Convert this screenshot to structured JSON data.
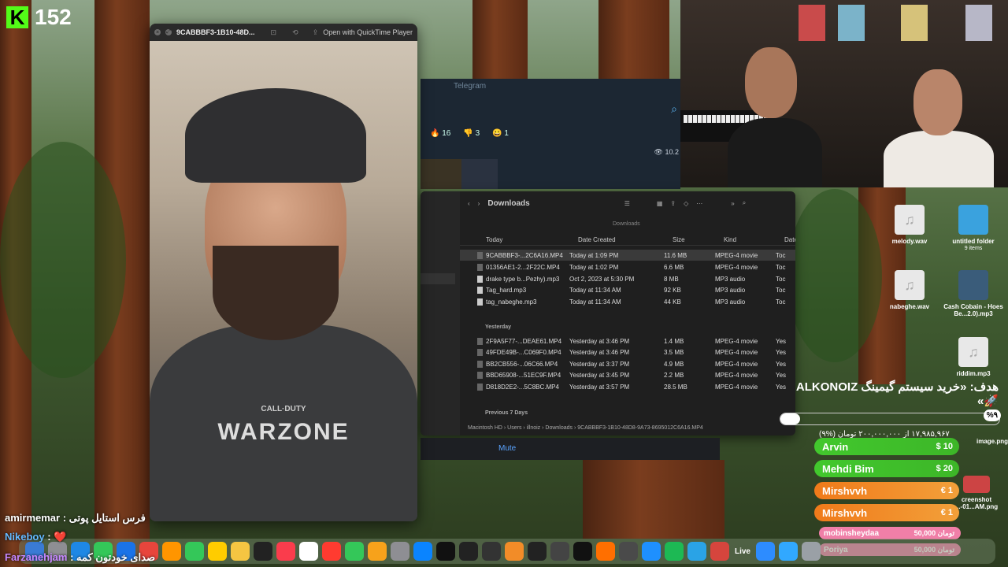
{
  "kick": {
    "count": "152",
    "logo": "K"
  },
  "quicktime": {
    "title": "9CABBBF3-1B10-48D...",
    "open_label": "Open with QuickTime Player",
    "hoodie_small": "CALL·DUTY",
    "hoodie_big": "WARZONE"
  },
  "telegram": {
    "title": "Telegram",
    "reactions": [
      "🔥 16",
      "👎 3",
      "😀 1"
    ],
    "views": "👁 10.2"
  },
  "finder": {
    "title": "Downloads",
    "subtitle": "Downloads",
    "columns": {
      "name": "Today",
      "date": "Date Created",
      "size": "Size",
      "kind": "Kind",
      "extra": "Date"
    },
    "sections": {
      "today": "Today",
      "yesterday": "Yesterday",
      "previous": "Previous 7 Days"
    },
    "today_rows": [
      {
        "name": "9CABBBF3-...2C6A16.MP4",
        "date": "Today at 1:09 PM",
        "size": "11.6 MB",
        "kind": "MPEG-4 movie",
        "extra": "Toc"
      },
      {
        "name": "01356AE1-2...2F22C.MP4",
        "date": "Today at 1:02 PM",
        "size": "6.6 MB",
        "kind": "MPEG-4 movie",
        "extra": "Toc"
      },
      {
        "name": "drake type b...Pezhy).mp3",
        "date": "Oct 2, 2023 at 5:30 PM",
        "size": "8 MB",
        "kind": "MP3 audio",
        "extra": "Toc"
      },
      {
        "name": "Tag_hard.mp3",
        "date": "Today at 11:34 AM",
        "size": "92 KB",
        "kind": "MP3 audio",
        "extra": "Toc"
      },
      {
        "name": "tag_nabeghe.mp3",
        "date": "Today at 11:34 AM",
        "size": "44 KB",
        "kind": "MP3 audio",
        "extra": "Toc"
      }
    ],
    "yesterday_rows": [
      {
        "name": "2F9A5F77-...DEAE61.MP4",
        "date": "Yesterday at 3:46 PM",
        "size": "1.4 MB",
        "kind": "MPEG-4 movie",
        "extra": "Yes"
      },
      {
        "name": "49FDE49B-...C069F0.MP4",
        "date": "Yesterday at 3:46 PM",
        "size": "3.5 MB",
        "kind": "MPEG-4 movie",
        "extra": "Yes"
      },
      {
        "name": "BB2CB556-...06C66.MP4",
        "date": "Yesterday at 3:37 PM",
        "size": "4.9 MB",
        "kind": "MPEG-4 movie",
        "extra": "Yes"
      },
      {
        "name": "BBD65908-...51EC9F.MP4",
        "date": "Yesterday at 3:45 PM",
        "size": "2.2 MB",
        "kind": "MPEG-4 movie",
        "extra": "Yes"
      },
      {
        "name": "D818D2E2-...5C8BC.MP4",
        "date": "Yesterday at 3:57 PM",
        "size": "28.5 MB",
        "kind": "MPEG-4 movie",
        "extra": "Yes"
      }
    ],
    "path": "Macintosh HD  ›  Users  ›  illnoiz  ›  Downloads  ›  9CABBBF3-1B10-48D8-9A73-8695012C6A16.MP4"
  },
  "mute_label": "Mute",
  "desktop_icons": [
    {
      "label": "melody.wav",
      "glyph": "♫"
    },
    {
      "label": "untitled folder",
      "sub": "9 items"
    },
    {
      "label": "nabeghe.wav",
      "glyph": "♫"
    },
    {
      "label": "Cash Cobain - Hoes Be...2.0).mp3"
    },
    {
      "label": "riddim.mp3",
      "glyph": "♫"
    },
    {
      "label": "image.png"
    },
    {
      "label": "creenshot ...-01...AM.png"
    }
  ],
  "goal": {
    "title": "هدف: «خرید سیستم گیمینگ ALKONOIZ 🚀»",
    "percent": "%۹",
    "progress_text": "۱۷,۹۸۵,۹۶۷ از ۲۰۰,۰۰۰,۰۰۰ تومان (%۹)",
    "fill_fraction": 0.09
  },
  "donations": [
    {
      "name": "Arvin",
      "amount": "$ 10",
      "color": "green"
    },
    {
      "name": "Mehdi Bim",
      "amount": "$ 20",
      "color": "green"
    },
    {
      "name": "Mirshvvh",
      "amount": "€ 1",
      "color": "orange"
    },
    {
      "name": "Mirshvvh",
      "amount": "€ 1",
      "color": "orange"
    }
  ],
  "small_donations": [
    {
      "name": "mobinsheydaa",
      "amount": "50,000 تومان"
    },
    {
      "name": "Poriya",
      "amount": "50,000 تومان"
    }
  ],
  "chat": [
    {
      "user": "amirmemar",
      "msg": " : فرس استایل پوتی"
    },
    {
      "user": "Nikeboy",
      "msg": " : ❤️"
    },
    {
      "user": "Farzanehjam",
      "msg": " : صدای خودتون کمه"
    }
  ],
  "dock": {
    "live_label": "Live",
    "apps": [
      "finder",
      "launchpad",
      "safari",
      "messages",
      "mail",
      "chrome",
      "photos",
      "facetime",
      "reminders",
      "notes",
      "tv",
      "music",
      "calendar",
      "news",
      "numbers",
      "pages",
      "settings",
      "appstore",
      "notion",
      "calendar2",
      "logic",
      "flstudio",
      "unity",
      "obs",
      "capcut",
      "fl",
      "finalcut",
      "files",
      "spotify",
      "telegram",
      "pdf",
      "zoom",
      "photoshop",
      "trash"
    ]
  }
}
